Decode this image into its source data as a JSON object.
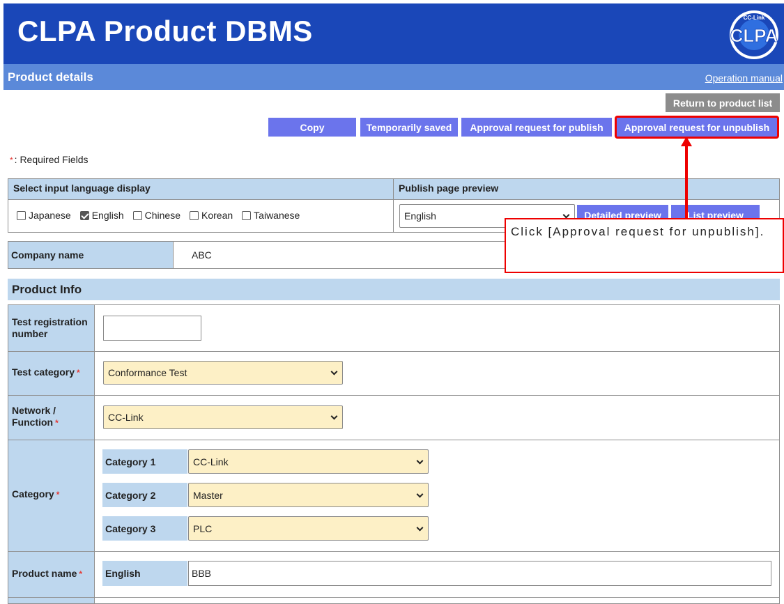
{
  "header": {
    "title": "CLPA Product DBMS",
    "logo_text": "CLPA",
    "logo_ring_text": "CC-Link"
  },
  "subheader": {
    "page_title": "Product details",
    "manual_link": "Operation manual"
  },
  "actions": {
    "return_list": "Return to product list",
    "copy": "Copy",
    "temp_saved": "Temporarily saved",
    "approve_publish": "Approval request for publish",
    "approve_unpublish": "Approval request for unpublish"
  },
  "required_note": {
    "star": "*",
    "text": ": Required Fields"
  },
  "language": {
    "header_select": "Select input language display",
    "header_preview": "Publish page preview",
    "options": [
      {
        "label": "Japanese",
        "checked": false
      },
      {
        "label": "English",
        "checked": true
      },
      {
        "label": "Chinese",
        "checked": false
      },
      {
        "label": "Korean",
        "checked": false
      },
      {
        "label": "Taiwanese",
        "checked": false
      }
    ],
    "preview_selected": "English",
    "detailed_preview": "Detailed preview",
    "list_preview": "List preview"
  },
  "company": {
    "label": "Company name",
    "value": "ABC"
  },
  "product_info": {
    "section_title": "Product Info",
    "test_reg_label": "Test registration number",
    "test_reg_value": "",
    "test_category_label": "Test category",
    "test_category_value": "Conformance Test",
    "network_label": "Network / Function",
    "network_value": "CC-Link",
    "category_label": "Category",
    "categories": [
      {
        "label": "Category 1",
        "value": "CC-Link"
      },
      {
        "label": "Category 2",
        "value": "Master"
      },
      {
        "label": "Category 3",
        "value": "PLC"
      }
    ],
    "product_name_label": "Product name",
    "product_name_lang": "English",
    "product_name_value": "BBB"
  },
  "callout": {
    "text": "Click [Approval request for unpublish]."
  },
  "colors": {
    "header": "#1a47b8",
    "subheader": "#5b89d9",
    "button_blue": "#6b74ec",
    "label_bg": "#bed7ee",
    "select_bg": "#fdf0c6",
    "highlight": "#e00000"
  }
}
